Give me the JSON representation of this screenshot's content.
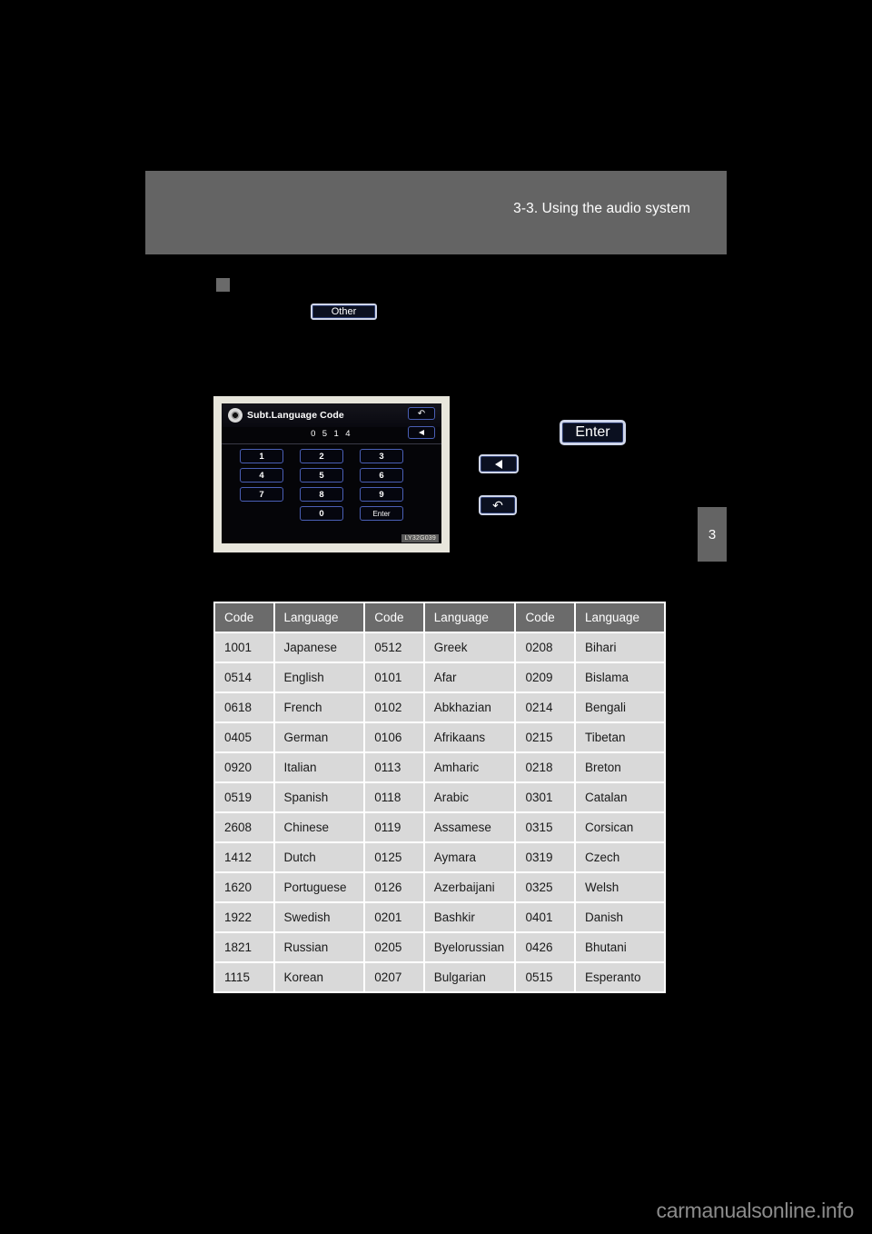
{
  "header": {
    "chapter_title": "3-3. Using the audio system",
    "page_tab": "3"
  },
  "section": {
    "bullet_icon": "square-bullet-icon",
    "other_button_label": "Other"
  },
  "side_buttons": {
    "enter_label": "Enter",
    "left_arrow_icon": "triangle-left-icon",
    "return_icon": "return-arrow-icon",
    "return_glyph": "↶"
  },
  "figure": {
    "caption": "LY32G039",
    "screen": {
      "disc_icon": "disc-icon",
      "title": "Subt.Language Code",
      "code_value": "0 5 1 4",
      "back_glyph": "↶",
      "delete_icon": "triangle-left-icon",
      "keys": [
        "1",
        "2",
        "3",
        "4",
        "5",
        "6",
        "7",
        "8",
        "9",
        "0"
      ],
      "enter_label": "Enter"
    }
  },
  "table": {
    "headers": [
      "Code",
      "Language",
      "Code",
      "Language",
      "Code",
      "Language"
    ],
    "rows": [
      [
        "1001",
        "Japanese",
        "0512",
        "Greek",
        "0208",
        "Bihari"
      ],
      [
        "0514",
        "English",
        "0101",
        "Afar",
        "0209",
        "Bislama"
      ],
      [
        "0618",
        "French",
        "0102",
        "Abkhazian",
        "0214",
        "Bengali"
      ],
      [
        "0405",
        "German",
        "0106",
        "Afrikaans",
        "0215",
        "Tibetan"
      ],
      [
        "0920",
        "Italian",
        "0113",
        "Amharic",
        "0218",
        "Breton"
      ],
      [
        "0519",
        "Spanish",
        "0118",
        "Arabic",
        "0301",
        "Catalan"
      ],
      [
        "2608",
        "Chinese",
        "0119",
        "Assamese",
        "0315",
        "Corsican"
      ],
      [
        "1412",
        "Dutch",
        "0125",
        "Aymara",
        "0319",
        "Czech"
      ],
      [
        "1620",
        "Portuguese",
        "0126",
        "Azerbaijani",
        "0325",
        "Welsh"
      ],
      [
        "1922",
        "Swedish",
        "0201",
        "Bashkir",
        "0401",
        "Danish"
      ],
      [
        "1821",
        "Russian",
        "0205",
        "Byelorussian",
        "0426",
        "Bhutani"
      ],
      [
        "1115",
        "Korean",
        "0207",
        "Bulgarian",
        "0515",
        "Esperanto"
      ]
    ]
  },
  "footer": {
    "watermark": "carmanualsonline.info"
  },
  "colors": {
    "page_background": "#000000",
    "header_bar": "#646464",
    "table_header": "#6b6b6b",
    "table_cell": "#d9d9d9",
    "button_fill": "#0b1020",
    "button_border": "#cfd6ea",
    "screen_key_border": "#4a5fb5",
    "figure_bezel": "#e8e6dc",
    "watermark": "#8c8c8c"
  }
}
